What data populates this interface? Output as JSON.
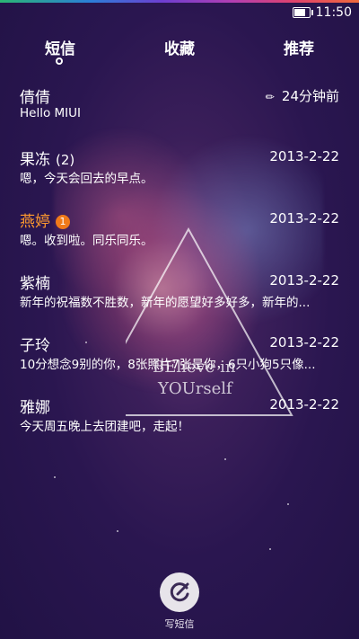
{
  "status": {
    "time": "11:50"
  },
  "tabs": [
    {
      "label": "短信",
      "active": true
    },
    {
      "label": "收藏"
    },
    {
      "label": "推荐"
    }
  ],
  "watermark": {
    "line1": "BElieve in",
    "line2": "YOUrself"
  },
  "messages": [
    {
      "name": "倩倩",
      "preview": "Hello MIUI",
      "time": "24分钟前",
      "draft": true
    },
    {
      "name": "果冻",
      "count": "(2)",
      "preview": "嗯，今天会回去的早点。",
      "time": "2013-2-22"
    },
    {
      "name": "燕婷",
      "badge": "1",
      "preview": "嗯。收到啦。同乐同乐。",
      "time": "2013-2-22",
      "highlight": true
    },
    {
      "name": "紫楠",
      "preview": "新年的祝福数不胜数，新年的愿望好多好多，新年的...",
      "time": "2013-2-22"
    },
    {
      "name": "子玲",
      "preview": "10分想念9别的你，8张照片7张是你，6只小狗5只像...",
      "time": "2013-2-22"
    },
    {
      "name": "雅娜",
      "preview": "今天周五晚上去团建吧，走起！",
      "time": "2013-2-22"
    }
  ],
  "compose": {
    "label": "写短信",
    "icon": "compose-icon"
  }
}
